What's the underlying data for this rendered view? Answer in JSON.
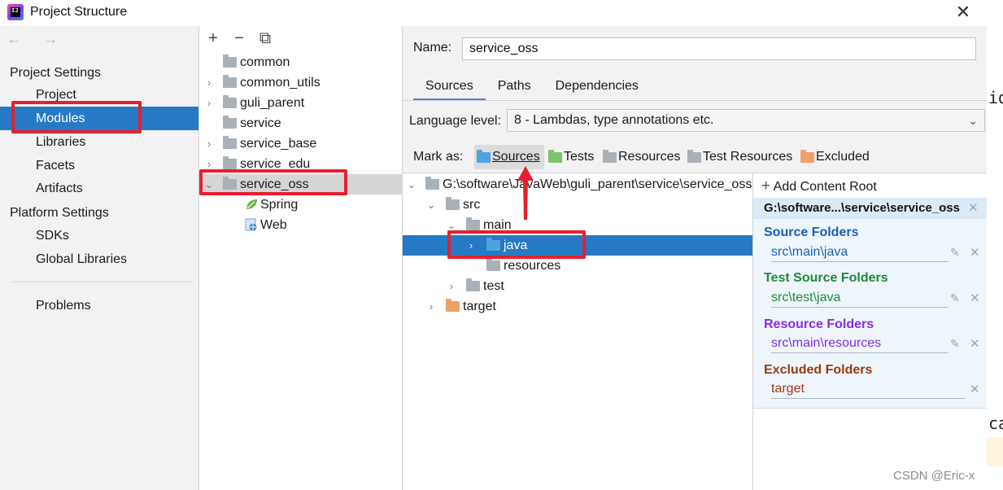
{
  "window": {
    "title": "Project Structure",
    "close_label": "✕"
  },
  "sidebar": {
    "nav_label": "← →",
    "project_settings_header": "Project Settings",
    "project_settings": [
      "Project",
      "Modules",
      "Libraries",
      "Facets",
      "Artifacts"
    ],
    "platform_settings_header": "Platform Settings",
    "platform_settings": [
      "SDKs",
      "Global Libraries"
    ],
    "problems": "Problems",
    "selected": "Modules"
  },
  "modules": {
    "toolbar": {
      "add": "+",
      "remove": "−",
      "copy": "⧉"
    },
    "items": [
      {
        "label": "common",
        "expandable": false
      },
      {
        "label": "common_utils",
        "expandable": true
      },
      {
        "label": "guli_parent",
        "expandable": true
      },
      {
        "label": "service",
        "expandable": false
      },
      {
        "label": "service_base",
        "expandable": true
      },
      {
        "label": "service_edu",
        "expandable": true
      },
      {
        "label": "service_oss",
        "expandable": true,
        "expanded": true
      }
    ],
    "facets": [
      "Spring",
      "Web"
    ],
    "selected": "service_oss"
  },
  "main": {
    "name_label": "Name:",
    "name_value": "service_oss",
    "tabs": [
      "Sources",
      "Paths",
      "Dependencies"
    ],
    "active_tab": "Sources",
    "language_level_label": "Language level:",
    "language_level_value": "8 - Lambdas, type annotations etc.",
    "mark_as_label": "Mark as:",
    "mark_as": [
      {
        "label": "Sources",
        "color": "#4fa3dd"
      },
      {
        "label": "Tests",
        "color": "#7cc36b"
      },
      {
        "label": "Resources",
        "color": "#a9b1b8"
      },
      {
        "label": "Test Resources",
        "color": "#a9b1b8"
      },
      {
        "label": "Excluded",
        "color": "#f0a06b"
      }
    ],
    "tree": [
      {
        "label": "G:\\software\\JavaWeb\\guli_parent\\service\\service_oss",
        "depth": 0,
        "chevron": "⌄",
        "folder_color": "#a9b1b8"
      },
      {
        "label": "src",
        "depth": 1,
        "chevron": "⌄",
        "folder_color": "#a9b1b8"
      },
      {
        "label": "main",
        "depth": 2,
        "chevron": "⌄",
        "folder_color": "#a9b1b8"
      },
      {
        "label": "java",
        "depth": 3,
        "chevron": "›",
        "folder_color": "#4fa3dd"
      },
      {
        "label": "resources",
        "depth": 3,
        "chevron": "",
        "folder_color": "#a9b1b8"
      },
      {
        "label": "test",
        "depth": 2,
        "chevron": "›",
        "folder_color": "#a9b1b8"
      },
      {
        "label": "target",
        "depth": 1,
        "chevron": "›",
        "folder_color": "#f0a06b"
      }
    ],
    "selected_tree_item": "java"
  },
  "roots": {
    "add_content_root": "Add Content Root",
    "root_path": "G:\\software...\\service\\service_oss",
    "groups": [
      {
        "title": "Source Folders",
        "entry": "src\\main\\java",
        "color": "#1a5fb4"
      },
      {
        "title": "Test Source Folders",
        "entry": "src\\test\\java",
        "color": "#1f8a3a"
      },
      {
        "title": "Resource Folders",
        "entry": "src\\main\\resources",
        "color": "#8a2be2"
      },
      {
        "title": "Excluded Folders",
        "entry": "target",
        "color": "#9a3b12"
      }
    ]
  },
  "background": {
    "peek_top": "id",
    "peek_bottom": "ca"
  },
  "watermark": "CSDN @Eric-x",
  "colors": {
    "selection": "#2679c4",
    "annotation": "#e5202e"
  }
}
